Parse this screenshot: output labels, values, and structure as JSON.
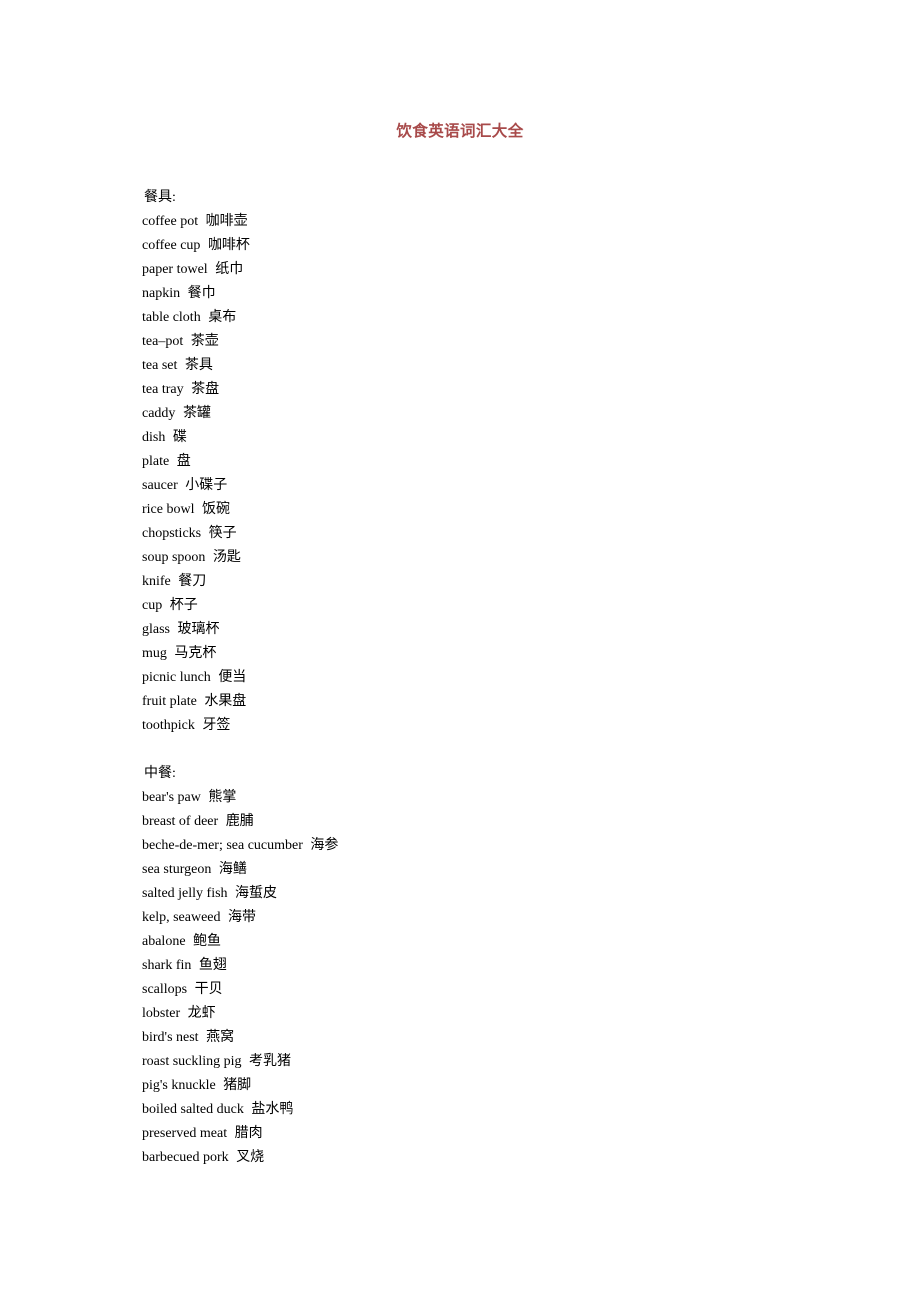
{
  "document": {
    "title": "饮食英语词汇大全",
    "title_color": "#a84a4a",
    "text_color": "#000000",
    "background_color": "#ffffff"
  },
  "sections": [
    {
      "heading": "餐具:",
      "items": [
        {
          "en": "coffee pot",
          "zh": "咖啡壶"
        },
        {
          "en": "coffee cup",
          "zh": "咖啡杯"
        },
        {
          "en": "paper towel",
          "zh": "纸巾"
        },
        {
          "en": "napkin",
          "zh": "餐巾"
        },
        {
          "en": "table cloth",
          "zh": "桌布"
        },
        {
          "en": "tea–pot",
          "zh": "茶壶"
        },
        {
          "en": "tea set",
          "zh": "茶具"
        },
        {
          "en": "tea tray",
          "zh": "茶盘"
        },
        {
          "en": "caddy",
          "zh": "茶罐"
        },
        {
          "en": "dish",
          "zh": "碟"
        },
        {
          "en": "plate",
          "zh": "盘"
        },
        {
          "en": "saucer",
          "zh": "小碟子"
        },
        {
          "en": "rice bowl",
          "zh": "饭碗"
        },
        {
          "en": "chopsticks",
          "zh": "筷子"
        },
        {
          "en": "soup spoon",
          "zh": "汤匙"
        },
        {
          "en": "knife",
          "zh": "餐刀"
        },
        {
          "en": "cup",
          "zh": "杯子"
        },
        {
          "en": "glass",
          "zh": "玻璃杯"
        },
        {
          "en": "mug",
          "zh": "马克杯"
        },
        {
          "en": "picnic lunch",
          "zh": "便当"
        },
        {
          "en": "fruit plate",
          "zh": "水果盘"
        },
        {
          "en": "toothpick",
          "zh": "牙签"
        }
      ]
    },
    {
      "heading": "中餐:",
      "items": [
        {
          "en": "bear's paw",
          "zh": "熊掌"
        },
        {
          "en": "breast of deer",
          "zh": "鹿脯"
        },
        {
          "en": "beche-de-mer; sea cucumber",
          "zh": "海参"
        },
        {
          "en": "sea sturgeon",
          "zh": "海鳝"
        },
        {
          "en": "salted jelly fish",
          "zh": "海蜇皮"
        },
        {
          "en": "kelp, seaweed",
          "zh": "海带"
        },
        {
          "en": "abalone",
          "zh": "鲍鱼"
        },
        {
          "en": "shark fin",
          "zh": "鱼翅"
        },
        {
          "en": "scallops",
          "zh": "干贝"
        },
        {
          "en": "lobster",
          "zh": "龙虾"
        },
        {
          "en": "bird's nest",
          "zh": "燕窝"
        },
        {
          "en": "roast suckling pig",
          "zh": "考乳猪"
        },
        {
          "en": "pig's knuckle",
          "zh": "猪脚"
        },
        {
          "en": "boiled salted duck",
          "zh": "盐水鸭"
        },
        {
          "en": "preserved meat",
          "zh": "腊肉"
        },
        {
          "en": "barbecued pork",
          "zh": "叉烧"
        }
      ]
    }
  ]
}
